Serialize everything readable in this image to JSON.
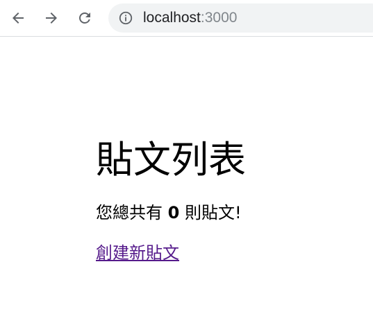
{
  "browser": {
    "url_host": "localhost",
    "url_port": ":3000",
    "back_icon": "arrow-left-icon",
    "forward_icon": "arrow-right-icon",
    "reload_icon": "reload-icon",
    "info_icon": "info-circle-icon"
  },
  "page": {
    "title": "貼文列表",
    "count_prefix": "您總共有 ",
    "count_value": "0",
    "count_suffix": " 則貼文!",
    "create_link": "創建新貼文"
  },
  "colors": {
    "link_visited": "#551a8b",
    "omnibox_bg": "#f1f3f4",
    "icon_gray": "#5f6368"
  }
}
